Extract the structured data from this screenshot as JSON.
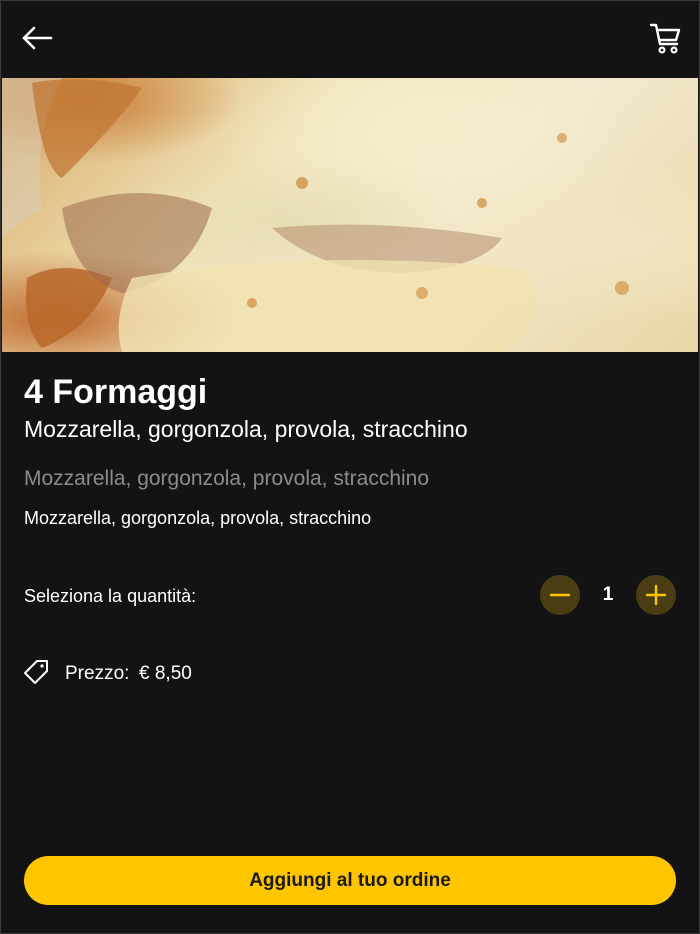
{
  "header": {
    "back_icon": "arrow-left-icon",
    "cart_icon": "shopping-cart-icon"
  },
  "hero": {
    "image_subject": "pizza-quattro-formaggi-photo"
  },
  "product": {
    "title": "4 Formaggi",
    "subtitle": "Mozzarella, gorgonzola, provola, stracchino",
    "description_muted": "Mozzarella, gorgonzola, provola, stracchino",
    "description": "Mozzarella, gorgonzola, provola, stracchino"
  },
  "quantity": {
    "label": "Seleziona la quantità:",
    "value": "1",
    "minus_icon": "minus-icon",
    "plus_icon": "plus-icon"
  },
  "price": {
    "icon": "price-tag-icon",
    "label": "Prezzo:",
    "value": "€ 8,50"
  },
  "cta": {
    "label": "Aggiungi al tuo ordine"
  },
  "colors": {
    "background": "#131313",
    "accent": "#ffc600",
    "accent_dark": "#4a3d13",
    "muted_text": "#8c8c8c"
  }
}
